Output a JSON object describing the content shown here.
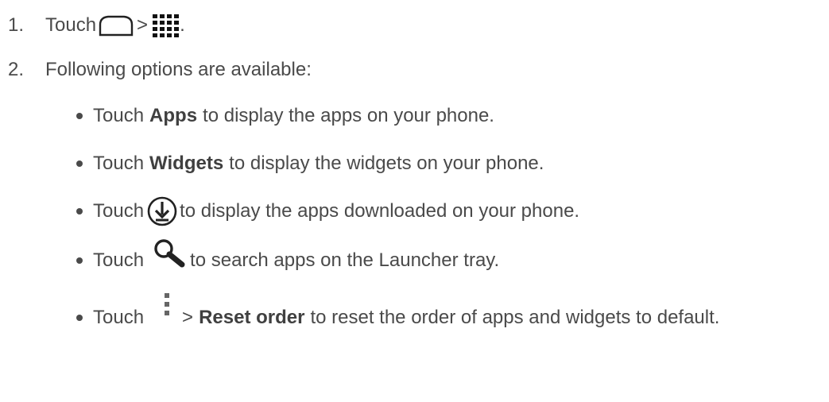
{
  "steps": [
    {
      "number": "1.",
      "prefix": "Touch",
      "sep": ">",
      "suffix": ".",
      "icon1": "home-icon",
      "icon2": "apps-grid-icon"
    },
    {
      "number": "2.",
      "text": "Following options are available:"
    }
  ],
  "options": [
    {
      "prefix": "Touch",
      "bold": "Apps",
      "suffix": "to display the apps on your phone."
    },
    {
      "prefix": "Touch",
      "bold": "Widgets",
      "suffix": "to display the widgets on your phone."
    },
    {
      "prefix": "Touch",
      "icon": "download-icon",
      "suffix": "to display the apps downloaded on your phone."
    },
    {
      "prefix": "Touch",
      "icon": "search-icon",
      "suffix": "to search apps on the Launcher tray."
    },
    {
      "prefix": "Touch",
      "icon": "menu-icon",
      "sep": ">",
      "bold": "Reset order",
      "suffix": "to reset the order of apps and widgets to default."
    }
  ]
}
